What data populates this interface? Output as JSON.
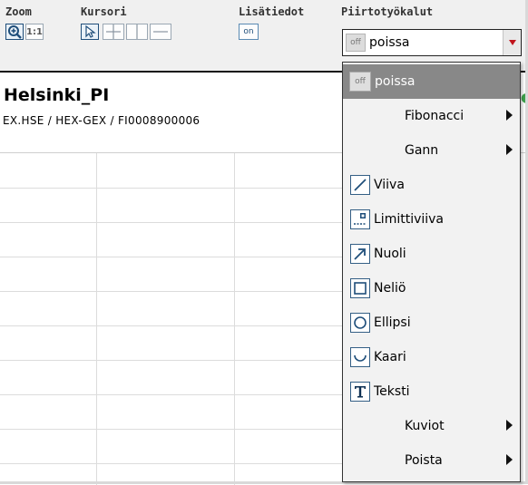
{
  "toolbar": {
    "zoom_label": "Zoom",
    "cursor_label": "Kursori",
    "info_label": "Lisätiedot",
    "drawing_label": "Piirtotyökalut",
    "zoom_reset": "1:1",
    "info_toggle": "on",
    "combo_badge": "off",
    "combo_value": "poissa"
  },
  "instrument": {
    "title": "Helsinki_PI",
    "path": "EX.HSE  /  HEX-GEX  /  FI0008900006"
  },
  "menu": {
    "items": [
      {
        "label": "poissa",
        "badge": "off",
        "highlighted": true
      },
      {
        "label": "Fibonacci",
        "submenu": true
      },
      {
        "label": "Gann",
        "submenu": true
      },
      {
        "label": "Viiva",
        "icon": "line-icon"
      },
      {
        "label": "Limittiviiva",
        "icon": "offset-line-icon"
      },
      {
        "label": "Nuoli",
        "icon": "arrow-icon"
      },
      {
        "label": "Neliö",
        "icon": "square-icon"
      },
      {
        "label": "Ellipsi",
        "icon": "ellipse-icon"
      },
      {
        "label": "Kaari",
        "icon": "arc-icon"
      },
      {
        "label": "Teksti",
        "icon": "text-icon"
      },
      {
        "label": "Kuviot",
        "submenu": true
      },
      {
        "label": "Poista",
        "submenu": true
      }
    ]
  },
  "colors": {
    "highlight": "#888888",
    "button_border": "#5a8ab3",
    "combo_arrow": "#c0141c"
  }
}
